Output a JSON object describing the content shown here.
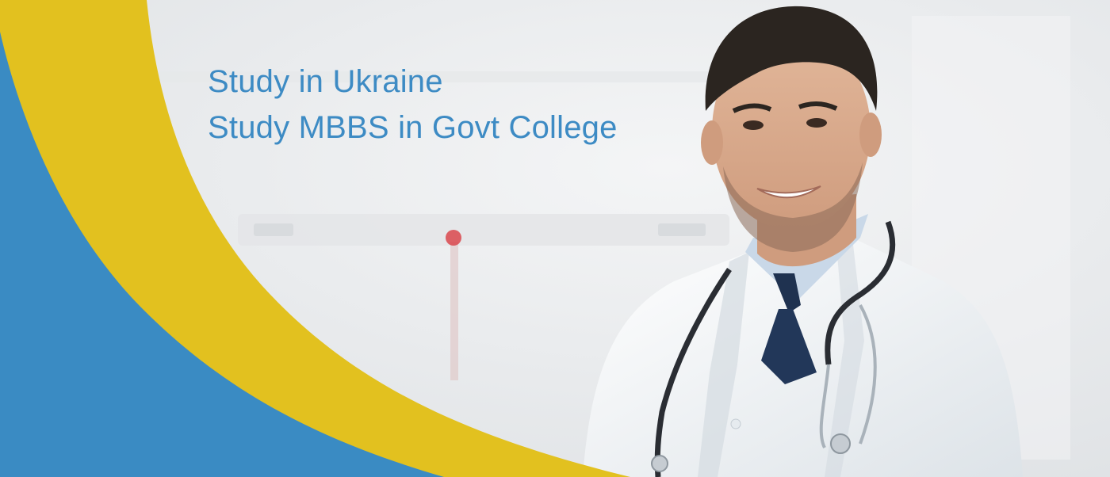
{
  "banner": {
    "headline_line1": "Study in Ukraine",
    "headline_line2": "Study MBBS in Govt College"
  },
  "colors": {
    "headline": "#3d8bc4",
    "flag_blue": "#3a8bc3",
    "flag_yellow": "#e2c11f",
    "background": "#eceef0"
  },
  "photo": {
    "subject": "smiling doctor in white coat with stethoscope and navy tie"
  }
}
